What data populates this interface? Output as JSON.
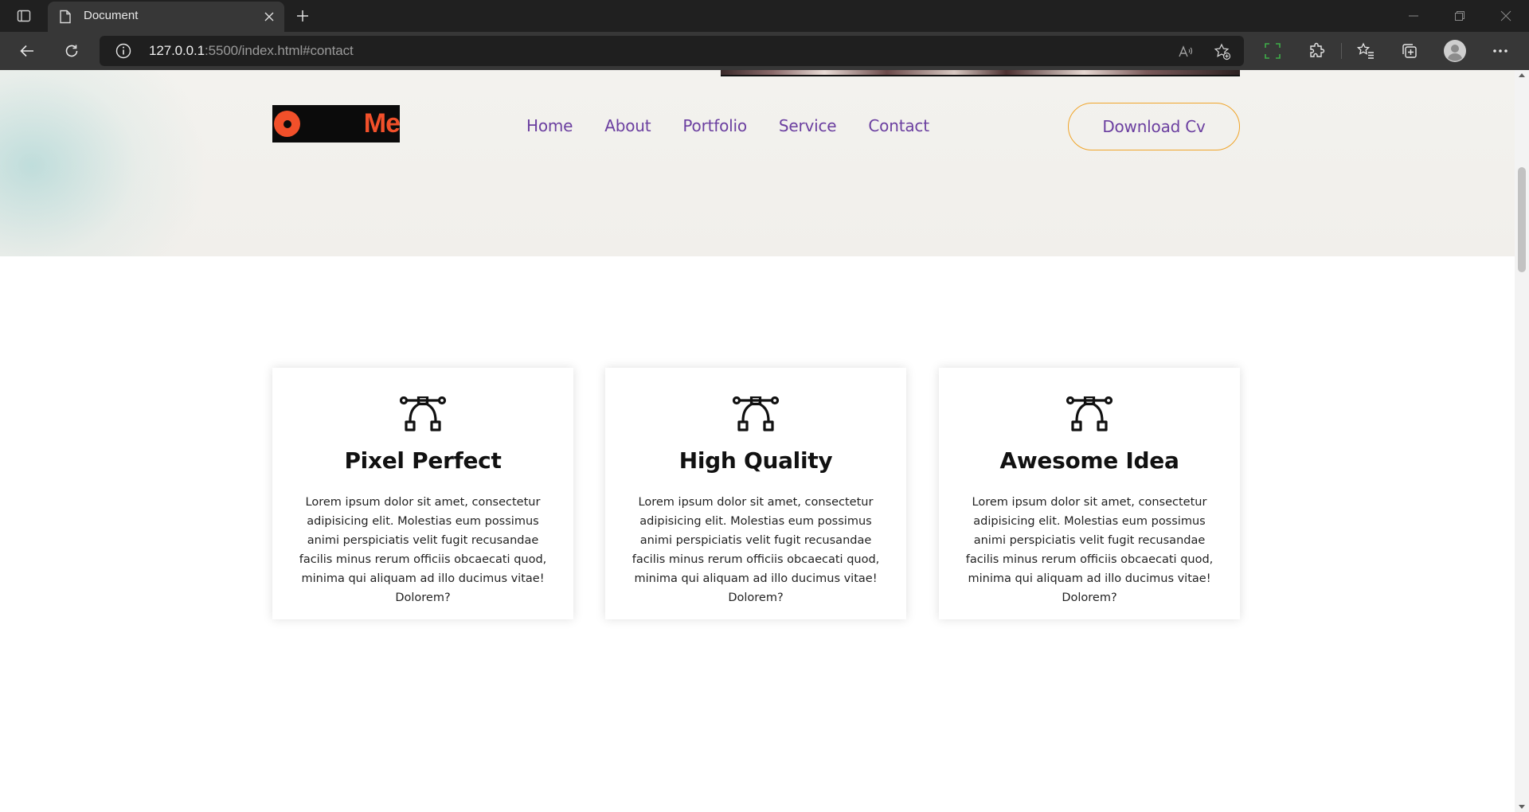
{
  "browser": {
    "tab_title": "Document",
    "url_host": "127.0.0.1",
    "url_rest": ":5500/index.html#contact"
  },
  "header": {
    "logo_text": "Me",
    "nav": [
      "Home",
      "About",
      "Portfolio",
      "Service",
      "Contact"
    ],
    "cta_label": "Download Cv"
  },
  "services": [
    {
      "icon": "bezier-curve-icon",
      "title": "Pixel Perfect",
      "text": "Lorem ipsum dolor sit amet, consectetur adipisicing elit. Molestias eum possimus animi perspiciatis velit fugit recusandae facilis minus rerum officiis obcaecati quod, minima qui aliquam ad illo ducimus vitae! Dolorem?"
    },
    {
      "icon": "bezier-curve-icon",
      "title": "High Quality",
      "text": "Lorem ipsum dolor sit amet, consectetur adipisicing elit. Molestias eum possimus animi perspiciatis velit fugit recusandae facilis minus rerum officiis obcaecati quod, minima qui aliquam ad illo ducimus vitae! Dolorem?"
    },
    {
      "icon": "bezier-curve-icon",
      "title": "Awesome Idea",
      "text": "Lorem ipsum dolor sit amet, consectetur adipisicing elit. Molestias eum possimus animi perspiciatis velit fugit recusandae facilis minus rerum officiis obcaecati quod, minima qui aliquam ad illo ducimus vitae! Dolorem?"
    }
  ],
  "colors": {
    "nav_text": "#6b3fa0",
    "cta_border": "#f0a52a",
    "logo_accent": "#f2502a"
  }
}
